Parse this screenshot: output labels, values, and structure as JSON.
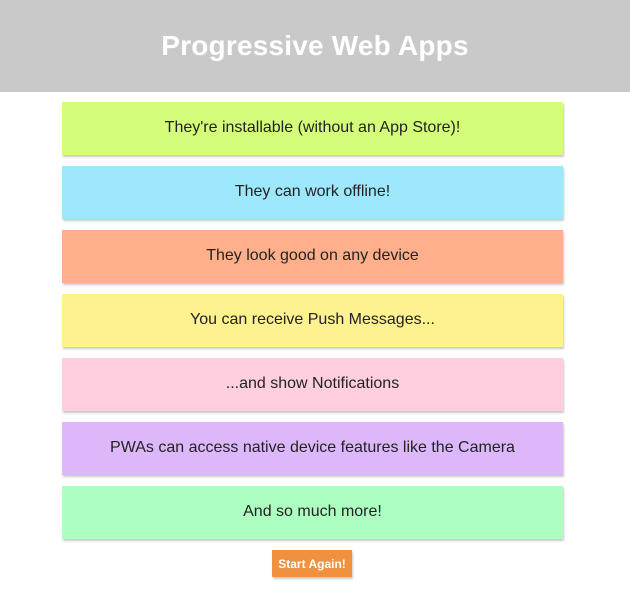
{
  "header": {
    "title": "Progressive Web Apps"
  },
  "cards": [
    {
      "text": "They're installable (without an App Store)!",
      "color": "#d4fd79"
    },
    {
      "text": "They can work offline!",
      "color": "#9de8fd"
    },
    {
      "text": "They look good on any device",
      "color": "#ffaf8a"
    },
    {
      "text": "You can receive Push Messages...",
      "color": "#fef18f"
    },
    {
      "text": "...and show Notifications",
      "color": "#ffcfdf"
    },
    {
      "text": "PWAs can access native device features like the Camera",
      "color": "#dcb8fa"
    },
    {
      "text": "And so much more!",
      "color": "#adffc1"
    }
  ],
  "restart_button": {
    "label": "Start Again!",
    "color": "#f0913f"
  }
}
